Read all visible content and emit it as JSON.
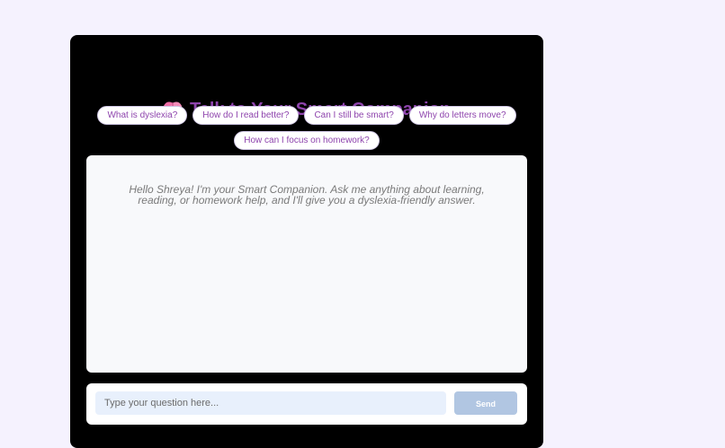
{
  "header": {
    "title": "Talk to Your Smart Companion",
    "icon": "brain-icon"
  },
  "suggestions": [
    "What is dyslexia?",
    "How do I read better?",
    "Can I still be smart?",
    "Why do letters move?",
    "How can I focus on homework?"
  ],
  "chat": {
    "greeting": "Hello Shreya! I'm your Smart Companion. Ask me anything about learning, reading, or homework help, and I'll give you a dyslexia-friendly answer."
  },
  "composer": {
    "placeholder": "Type your question here...",
    "value": "",
    "send_label": "Send"
  },
  "colors": {
    "page_background": "#f5f2fe",
    "panel_background": "#000000",
    "accent": "#8e44ad",
    "brain_icon": "#f06fa8",
    "send_button": "#b1c6e2",
    "input_background": "#e8f0fc"
  }
}
